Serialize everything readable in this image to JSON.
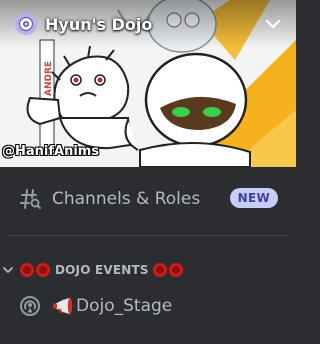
{
  "server": {
    "name": "Hyun's Dojo",
    "banner_watermark": "@HanifAnims",
    "banner_side_text": "ANDRE",
    "icon": "server-avatar-icon"
  },
  "channels_roles": {
    "label": "Channels & Roles",
    "badge": "NEW",
    "icon": "hash-search-icon"
  },
  "category": {
    "label": "DOJO EVENTS",
    "icon": "chevron-down-icon",
    "emoji": "red-circle-emoji"
  },
  "stage_channel": {
    "label": "Dojo_Stage",
    "icon": "stage-icon",
    "emoji": "megaphone-emoji"
  },
  "colors": {
    "sidebar_bg": "#2b2d31",
    "text_muted": "#b5bac1",
    "badge_bg": "#c9cdfb",
    "badge_text": "#3b41a8",
    "banner_accent": "#f2a916"
  }
}
